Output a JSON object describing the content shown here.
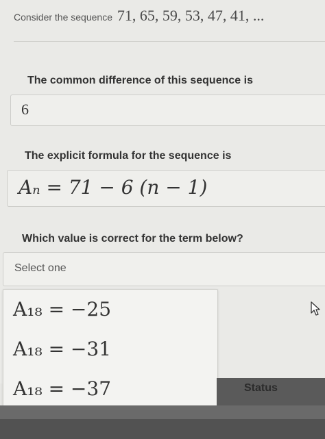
{
  "header": {
    "prompt": "Consider the sequence",
    "sequence": "71, 65, 59, 53, 47, 41, ..."
  },
  "q1": {
    "label": "The common difference of this sequence is",
    "answer": "6"
  },
  "q2": {
    "label": "The explicit formula for the sequence is",
    "formula": "Aₙ = 71 − 6 (n − 1)"
  },
  "q3": {
    "label": "Which value is correct for the term below?",
    "select_placeholder": "Select one",
    "options": [
      "A₁₈ = −25",
      "A₁₈ = −31",
      "A₁₈ = −37"
    ]
  },
  "footer": {
    "status_label": "Status"
  },
  "colors": {
    "background": "#eaeae7",
    "field": "#efefec",
    "status_bar": "#5a5a5a"
  }
}
